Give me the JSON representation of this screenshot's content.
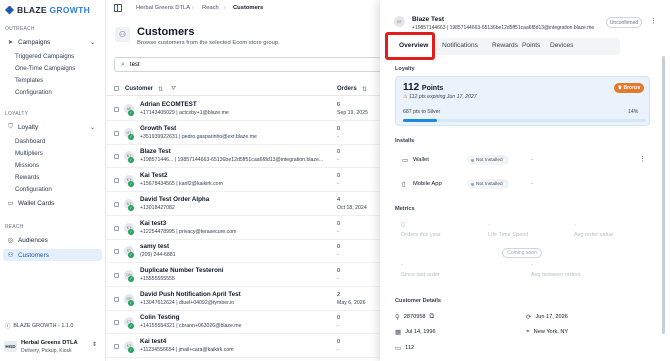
{
  "brand": {
    "name_a": "BLAZE ",
    "name_b": "GROWTH"
  },
  "sidebar": {
    "outreach_label": "OUTREACH",
    "campaigns": "Campaigns",
    "campaign_items": [
      "Triggered Campaigns",
      "One-Time Campaigns",
      "Templates",
      "Configuration"
    ],
    "loyalty_label": "LOYALTY",
    "loyalty": "Loyalty",
    "loyalty_items": [
      "Dashboard",
      "Multipliers",
      "Missions",
      "Rewards",
      "Configuration"
    ],
    "wallet_cards": "Wallet Cards",
    "reach_label": "REACH",
    "audiences": "Audiences",
    "customers": "Customers",
    "version": "BLAZE GROWTH - 1.1.0",
    "store_badge": "HGD",
    "store_name": "Herbal Greens DTLA",
    "store_sub": "Delivery, Pickup, Kiosk"
  },
  "breadcrumb": {
    "store": "Herbal Greens DTLA",
    "section": "Reach",
    "page": "Customers"
  },
  "page": {
    "title": "Customers",
    "subtitle": "Browse customers from the selected Ecom store group."
  },
  "search": {
    "value": "test",
    "placeholder": "Search"
  },
  "table": {
    "col_customer": "Customer",
    "col_orders": "Orders",
    "rows": [
      {
        "initials": "AE",
        "name": "Adrian ECOMTEST",
        "sub": "+17143405029 | actcsby+1@blaze.me",
        "orders": "6",
        "date": "Sep 19, 2025"
      },
      {
        "initials": "GT",
        "name": "Growth Test",
        "sub": "+351939922631 | pedro.gasparinho@ext.blaze.me",
        "orders": "0",
        "date": "-"
      },
      {
        "initials": "BT",
        "name": "Blaze Test",
        "sub": "+198571446... | 19857144663-65136be12d5ff51caa6f8d13@integration.blaze...",
        "orders": "0",
        "date": "-"
      },
      {
        "initials": "KT",
        "name": "Kai Test2",
        "sub": "+15678434565 | karif2@kaikirk.com",
        "orders": "0",
        "date": "-"
      },
      {
        "initials": "DT",
        "name": "David Test Order Alpha",
        "sub": "+13018427082",
        "orders": "4",
        "date": "Oct 18, 2024"
      },
      {
        "initials": "KT",
        "name": "Kai test3",
        "sub": "+12254478995 | privacy@terasecure.com",
        "orders": "0",
        "date": "-"
      },
      {
        "initials": "ST",
        "name": "samy test",
        "sub": "(209) 244-6881",
        "orders": "0",
        "date": "-"
      },
      {
        "initials": "DN",
        "name": "Duplicate Number Testeroni",
        "sub": "+15555555555",
        "orders": "0",
        "date": "-"
      },
      {
        "initials": "DP",
        "name": "David Push Notification April Test",
        "sub": "+13047612624 | dtuel+04092@tymber.io",
        "orders": "2",
        "date": "May 6, 2026"
      },
      {
        "initials": "CT",
        "name": "Colin Testing",
        "sub": "+14155554321 | cbrann+063026@blaze.me",
        "orders": "0",
        "date": "-"
      },
      {
        "initials": "KT",
        "name": "Kai test4",
        "sub": "+11234556654 | jmail+cara@kaikirk.com",
        "orders": "0",
        "date": "-"
      }
    ]
  },
  "detail": {
    "initials": "BT",
    "name": "Blaze Test",
    "sub": "+19857144663 | 19857144663-65136be12d5ff51caa6f8d13@integration.blaze.me",
    "status": "Unconfirmed",
    "tabs": [
      "Overview",
      "Notifications",
      "Rewards",
      "Points",
      "Devices"
    ],
    "loyalty_label": "Loyalty",
    "points": "112",
    "points_word": "Points",
    "expiring": "112 pts expiring Jun 17, 2027",
    "tier": "Bronze",
    "to_silver": "687 pts to Silver",
    "progress_pct": "14%",
    "progress_value": 14,
    "installs_label": "Installs",
    "installs": [
      {
        "name": "Wallet",
        "status": "Not Installed",
        "value": "-"
      },
      {
        "name": "Mobile App",
        "status": "Not Installed",
        "value": "-"
      }
    ],
    "metrics_label": "Metrics",
    "metrics": [
      {
        "value": "0",
        "label": "Orders this year"
      },
      {
        "value": "-",
        "label": "Life Time Spend"
      },
      {
        "value": "-",
        "label": "Avg order value"
      },
      {
        "value": "-",
        "label": "Since last order"
      },
      {
        "value": "-",
        "label": "Avg between orders"
      }
    ],
    "coming_soon": "Coming soon",
    "cust_details_label": "Customer Details",
    "customer_id": "2870958",
    "join_date": "Jun 17, 2026",
    "birthday": "Jul 14, 1996",
    "location": "New York, NY",
    "card_value": "112"
  }
}
